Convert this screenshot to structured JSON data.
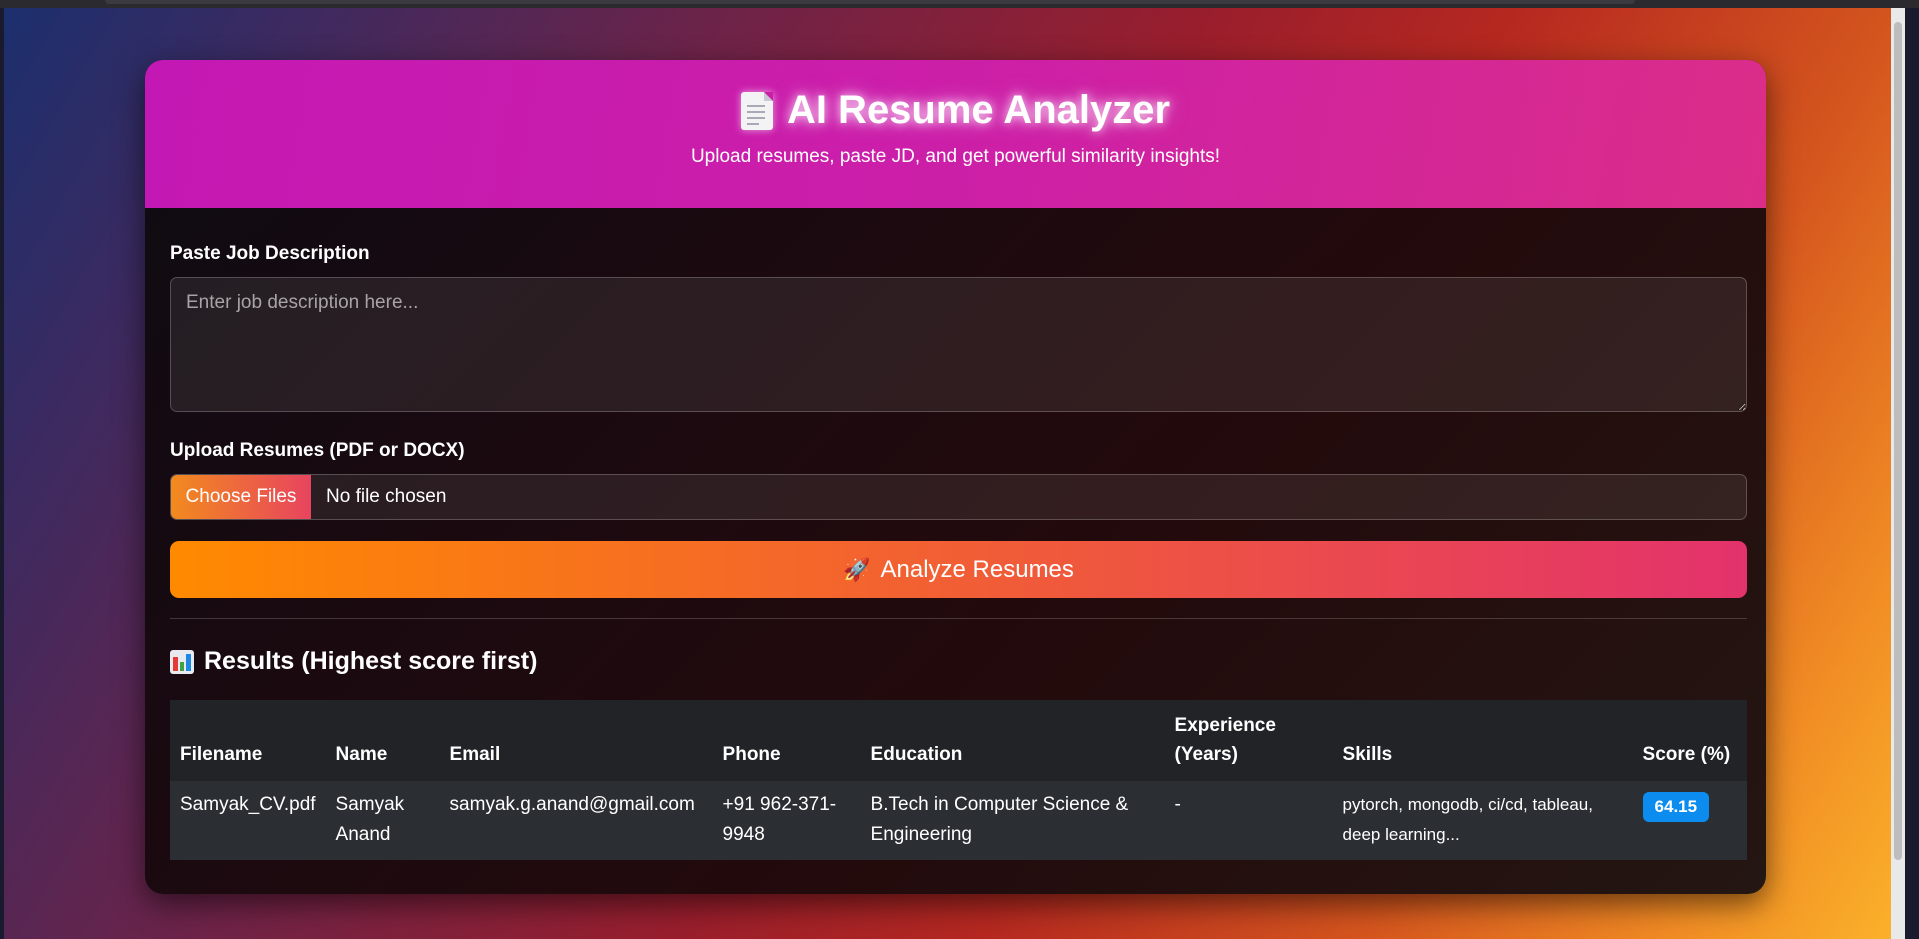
{
  "app": {
    "title": "AI Resume Analyzer",
    "subtitle": "Upload resumes, paste JD, and get powerful similarity insights!",
    "title_icon": "document-icon"
  },
  "form": {
    "jd_label": "Paste Job Description",
    "jd_placeholder": "Enter job description here...",
    "jd_value": "",
    "upload_label": "Upload Resumes (PDF or DOCX)",
    "choose_files_label": "Choose Files",
    "file_status": "No file chosen",
    "analyze_button_label": "Analyze Resumes",
    "analyze_icon": "rocket-icon"
  },
  "results": {
    "title": "Results (Highest score first)",
    "title_icon": "bar-chart-icon",
    "columns": [
      "Filename",
      "Name",
      "Email",
      "Phone",
      "Education",
      "Experience (Years)",
      "Skills",
      "Score (%)"
    ],
    "rows": [
      {
        "filename": "Samyak_CV.pdf",
        "name": "Samyak Anand",
        "email": "samyak.g.anand@gmail.com",
        "phone": "+91 962-371-9948",
        "education": "B.Tech in Computer Science & Engineering",
        "experience": "-",
        "skills": "pytorch, mongodb, ci/cd, tableau, deep learning...",
        "score": "64.15"
      }
    ]
  },
  "colors": {
    "header_gradient_start": "#c418b4",
    "header_gradient_end": "#db2d88",
    "button_gradient_start": "#ff8a00",
    "button_gradient_end": "#e3326c",
    "score_badge": "#0d8cf0"
  }
}
